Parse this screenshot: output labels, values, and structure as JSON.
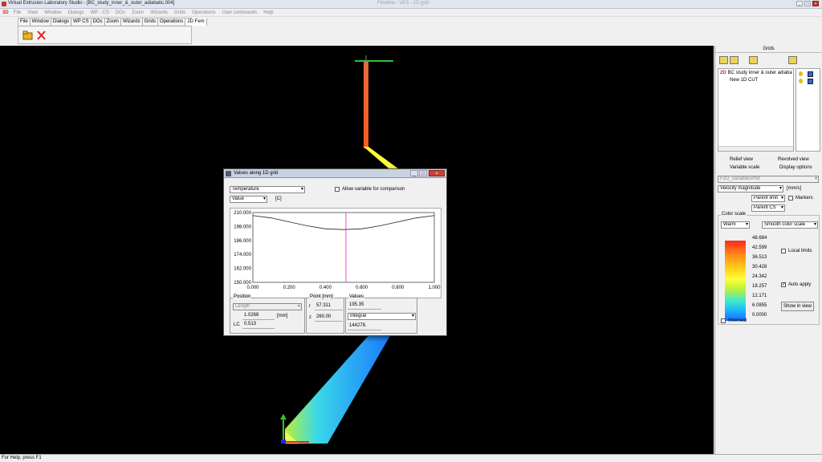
{
  "window": {
    "title": "Virtual Extrusion Laboratory Studio - [BC_study_inner_&_outer_adiabatic.004]",
    "ghost_title": "Flowline - VES - 1D grid"
  },
  "menu": {
    "logo": "3D",
    "items": [
      "File",
      "View",
      "Window",
      "Dialogs",
      "WP - CS",
      "DOs",
      "Zoom",
      "Wizards",
      "Grids",
      "Operations",
      "User commands",
      "Help"
    ]
  },
  "toolbar": {
    "tabs": [
      "File",
      "Window",
      "Dialogs",
      "WP CS",
      "DOs",
      "Zoom",
      "Wizards",
      "Grids",
      "Operations",
      "2D Fem"
    ]
  },
  "right_panel": {
    "title": "Grids",
    "tree": {
      "root_prefix": "2D",
      "root": "BC study inner & outer adiaba",
      "child": "New 1D CUT"
    },
    "tabs": {
      "relief": "Relief view",
      "revolved": "Revolved view",
      "variable_scale": "Variable scale",
      "display_options": "Display options"
    },
    "plot_select": "F2D_VariablesPlot",
    "variable": "Velocity magnitude",
    "unit": "[mm/s]",
    "parent_limit": "Parent limit",
    "markers": "Markers",
    "parent_cs": "Parent CS",
    "color_scale": {
      "label": "Color scale",
      "palette": "Warm",
      "mode": "Smooth color scale",
      "ticks": [
        "48.684",
        "42.599",
        "36.513",
        "30.428",
        "24.342",
        "18.257",
        "12.171",
        "6.0855",
        "0.0000"
      ],
      "local_limits": "Local limits",
      "auto_apply": "Auto apply",
      "show_in_view": "Show in view",
      "inversed": "Inversed"
    }
  },
  "dialog": {
    "title": "Values along 1D grid",
    "variable": "Temperature",
    "mode": "Value",
    "unit": "[C]",
    "allow_comparison": "Allow variable for comparison",
    "position": {
      "label": "Position",
      "type": "Length",
      "value": "1.0268",
      "unit": "[mm]",
      "lc_label": "LC",
      "lc": "0.513"
    },
    "point": {
      "label": "Point [mm]",
      "r_label": "r",
      "r": "57.311",
      "z_label": "z",
      "z": "260.00"
    },
    "values": {
      "label": "Values",
      "value": "195.35",
      "mode": "Integral",
      "integral": "144278."
    }
  },
  "chart_data": {
    "type": "line",
    "x_ticks": [
      "0.000",
      "0.200",
      "0.400",
      "0.600",
      "0.800",
      "1.000"
    ],
    "y_ticks": [
      "210.000",
      "198.000",
      "186.000",
      "174.000",
      "162.000",
      "150.000"
    ],
    "xlim": [
      0,
      1
    ],
    "ylim": [
      150,
      210
    ],
    "x": [
      0,
      0.1,
      0.2,
      0.3,
      0.4,
      0.5,
      0.6,
      0.7,
      0.8,
      0.9,
      1.0
    ],
    "y": [
      207.4,
      205.4,
      202.0,
      198.6,
      196.0,
      195.4,
      196.0,
      198.6,
      202.0,
      205.4,
      207.4
    ],
    "cursor_x": 0.513
  },
  "status": "For Help, press F1"
}
